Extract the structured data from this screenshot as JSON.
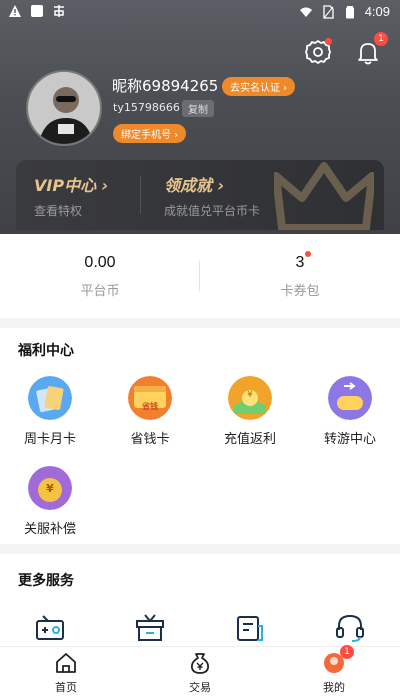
{
  "status_bar": {
    "time": "4:09",
    "left_icons": [
      "warning-icon",
      "square-icon",
      "app-icon"
    ],
    "right_icons": [
      "wifi-icon",
      "sim-icon",
      "battery-icon"
    ]
  },
  "header": {
    "nickname": "昵称69894265",
    "realname_button": "去实名认证 ›",
    "user_id": "ty15798666",
    "copy_button": "复制",
    "bind_phone_button": "绑定手机号 ›",
    "notification_count": "1"
  },
  "vip_card": {
    "left": {
      "title": "VIP中心 ›",
      "subtitle": "查看特权"
    },
    "right": {
      "title": "领成就 ›",
      "subtitle": "成就值兑平台币卡"
    }
  },
  "stats": [
    {
      "value": "0.00",
      "label": "平台币"
    },
    {
      "value": "3",
      "label": "卡券包"
    }
  ],
  "welfare": {
    "title": "福利中心",
    "items": [
      {
        "label": "周卡月卡",
        "icon": "weekly-card-icon",
        "color": "#5aa8f0"
      },
      {
        "label": "省钱卡",
        "icon": "save-money-card-icon",
        "color": "#f0802e"
      },
      {
        "label": "充值返利",
        "icon": "recharge-rebate-icon",
        "color": "#f2a42a"
      },
      {
        "label": "转游中心",
        "icon": "game-transfer-icon",
        "color": "#8d76e6"
      },
      {
        "label": "关服补偿",
        "icon": "shutdown-compensation-icon",
        "color": "#a06ad8"
      }
    ],
    "coin_symbol": "¥",
    "card_text": "省钱"
  },
  "more_services": {
    "title": "更多服务",
    "icons": [
      "radio-icon",
      "gift-box-icon",
      "document-icon",
      "headset-icon"
    ]
  },
  "tabbar": {
    "items": [
      {
        "label": "首页",
        "icon": "home-icon"
      },
      {
        "label": "交易",
        "icon": "money-bag-icon"
      },
      {
        "label": "我的",
        "icon": "profile-icon",
        "badge": "1"
      }
    ]
  },
  "colors": {
    "accent": "#ee8a2a",
    "badge_red": "#ff4b40",
    "vip_gold": "#e6c48d"
  }
}
